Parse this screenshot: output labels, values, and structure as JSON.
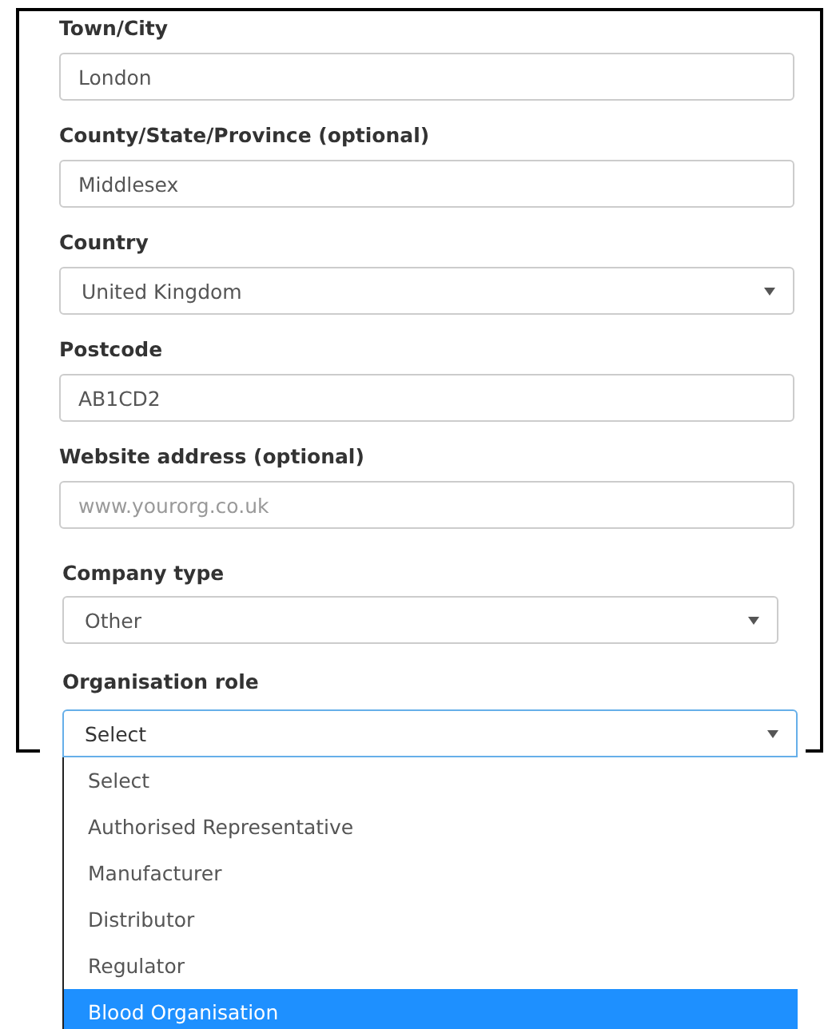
{
  "fields": [
    {
      "kind": "text",
      "label": "Town/City",
      "value": "London"
    },
    {
      "kind": "text",
      "label": "County/State/Province (optional)",
      "value": "Middlesex"
    },
    {
      "kind": "select",
      "label": "Country",
      "value": "United Kingdom"
    },
    {
      "kind": "text",
      "label": "Postcode",
      "value": "AB1CD2"
    },
    {
      "kind": "text",
      "label": "Website address (optional)",
      "placeholder": "www.yourorg.co.uk"
    }
  ],
  "company_fields": [
    {
      "kind": "select",
      "label": "Company type",
      "value": "Other",
      "focused": false
    }
  ],
  "role_field": {
    "kind": "select",
    "label": "Organisation role",
    "value": "Select",
    "focused": true,
    "expanded": true,
    "options": [
      {
        "label": "Select",
        "highlighted": false
      },
      {
        "label": "Authorised Representative",
        "highlighted": false
      },
      {
        "label": "Manufacturer",
        "highlighted": false
      },
      {
        "label": "Distributor",
        "highlighted": false
      },
      {
        "label": "Regulator",
        "highlighted": false
      },
      {
        "label": "Blood Organisation",
        "highlighted": true
      }
    ]
  }
}
